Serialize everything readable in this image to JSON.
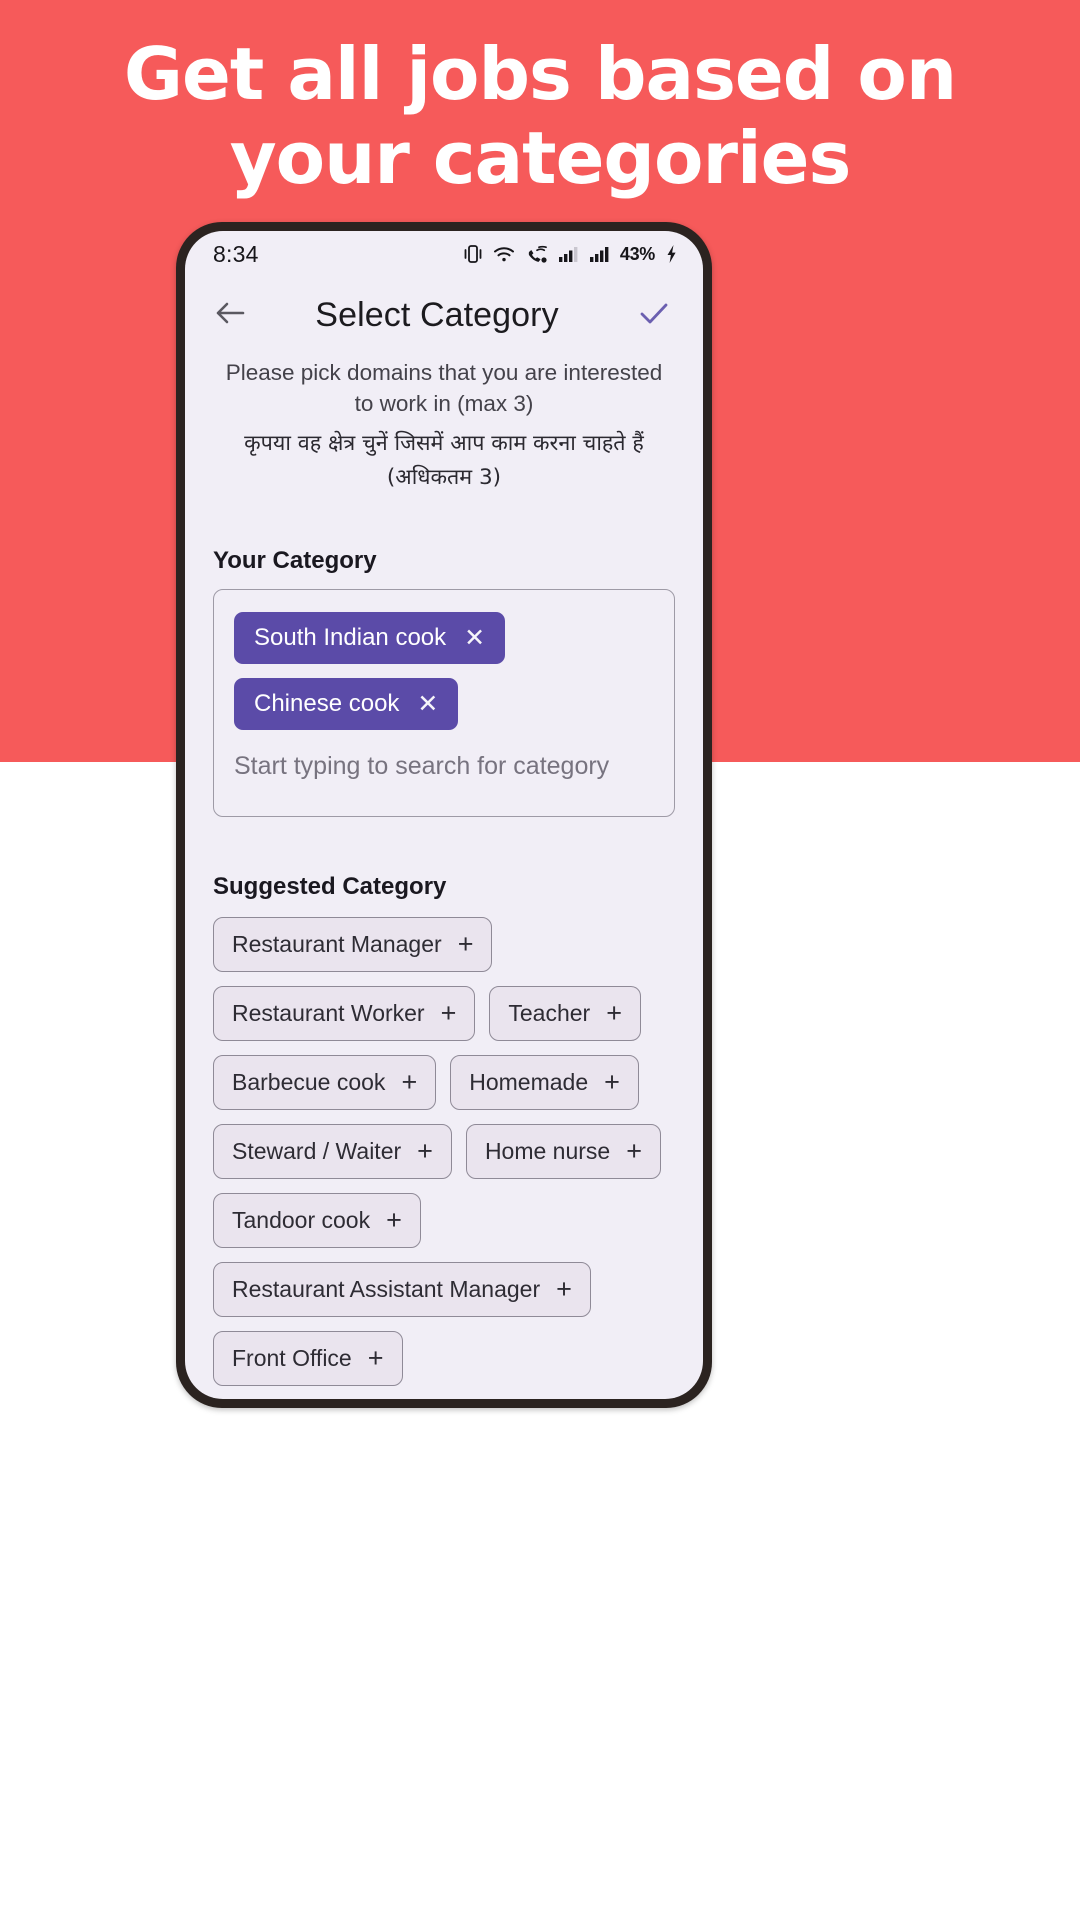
{
  "hero": {
    "line1": "Get all jobs based on",
    "line2": "your categories",
    "bg_color": "#F65A5A",
    "text_color": "#FFFFFF"
  },
  "phone": {
    "status_bar": {
      "time": "8:34",
      "battery_percent": "43%",
      "icons": [
        "vibrate-icon",
        "wifi-icon",
        "call-mute-icon",
        "signal-bars-icon",
        "signal-bars-icon",
        "charging-bolt-icon"
      ]
    },
    "app_bar": {
      "back_icon": "arrow-left-icon",
      "title": "Select Category",
      "confirm_icon": "check-icon"
    },
    "subtitle_en": "Please pick domains that you are interested to work in (max 3)",
    "subtitle_hi": "कृपया वह क्षेत्र चुनें जिसमें आप काम करना चाहते हैं (अधिकतम 3)",
    "your_category": {
      "label": "Your Category",
      "selected": [
        {
          "label": "South Indian cook",
          "remove_icon": "close-icon"
        },
        {
          "label": "Chinese cook",
          "remove_icon": "close-icon"
        }
      ],
      "placeholder": "Start typing to search for category",
      "chip_color": "#5B4BA8"
    },
    "suggested": {
      "label": "Suggested Category",
      "add_icon": "plus-icon",
      "items": [
        "Restaurant Manager",
        "Restaurant Worker",
        "Teacher",
        "Barbecue cook",
        "Homemade",
        "Steward / Waiter",
        "Home nurse",
        "Tandoor cook",
        "Restaurant Assistant Manager",
        "Front Office"
      ]
    }
  }
}
